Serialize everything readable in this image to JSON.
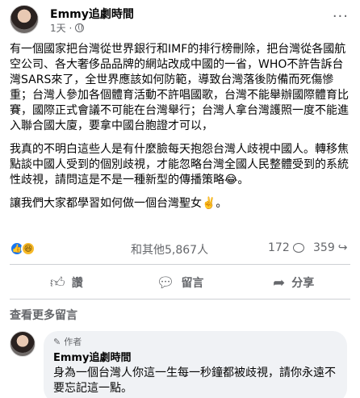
{
  "post": {
    "author": "Emmy追劇時間",
    "time": "1天 ·",
    "more": "···",
    "paragraphs": [
      "有一個國家把台灣從世界銀行和IMF的排行榜刪除，把台灣從各國航空公司、各大奢侈品品牌的網站改成中國的一省，WHO不許告訴台灣SARS來了，全世界應該如何防範，導致台灣落後防備而死傷慘重；台灣人參加各個體育活動不許唱國歌，台灣不能舉辦國際體育比賽，國際正式會議不可能在台灣舉行；台灣人拿台灣護照一度不能進入聯合國大廈，要拿中國台胞證才可以，",
      "我真的不明白這些人是有什麼臉每天抱怨台灣人歧視中國人。轉移焦點談中國人受到的個別歧視，才能忽略台灣全國人民整體受到的系統性歧視，請問這是不是一種新型的傳播策略😂。",
      "讓我們大家都學習如何做一個台灣聖女✌️。"
    ]
  },
  "stats": {
    "reactions": "和其他5,867人",
    "comments": "172",
    "shares": "359"
  },
  "actions": {
    "like": "讚",
    "comment": "留言",
    "share": "分享"
  },
  "see_more": "查看更多留言",
  "comment": {
    "badge": "作者",
    "author": "Emmy追劇時間",
    "text": "身為一個台灣人你這一生每一秒鐘都被歧視，請你永遠不要忘記這一點。"
  },
  "icons": {
    "like_reaction": "thumbs-up",
    "haha_reaction": "laughing-face",
    "colors": {
      "like_blue": "#1877f2",
      "haha_yellow": "#f7b928",
      "muted": "#65676b"
    }
  }
}
